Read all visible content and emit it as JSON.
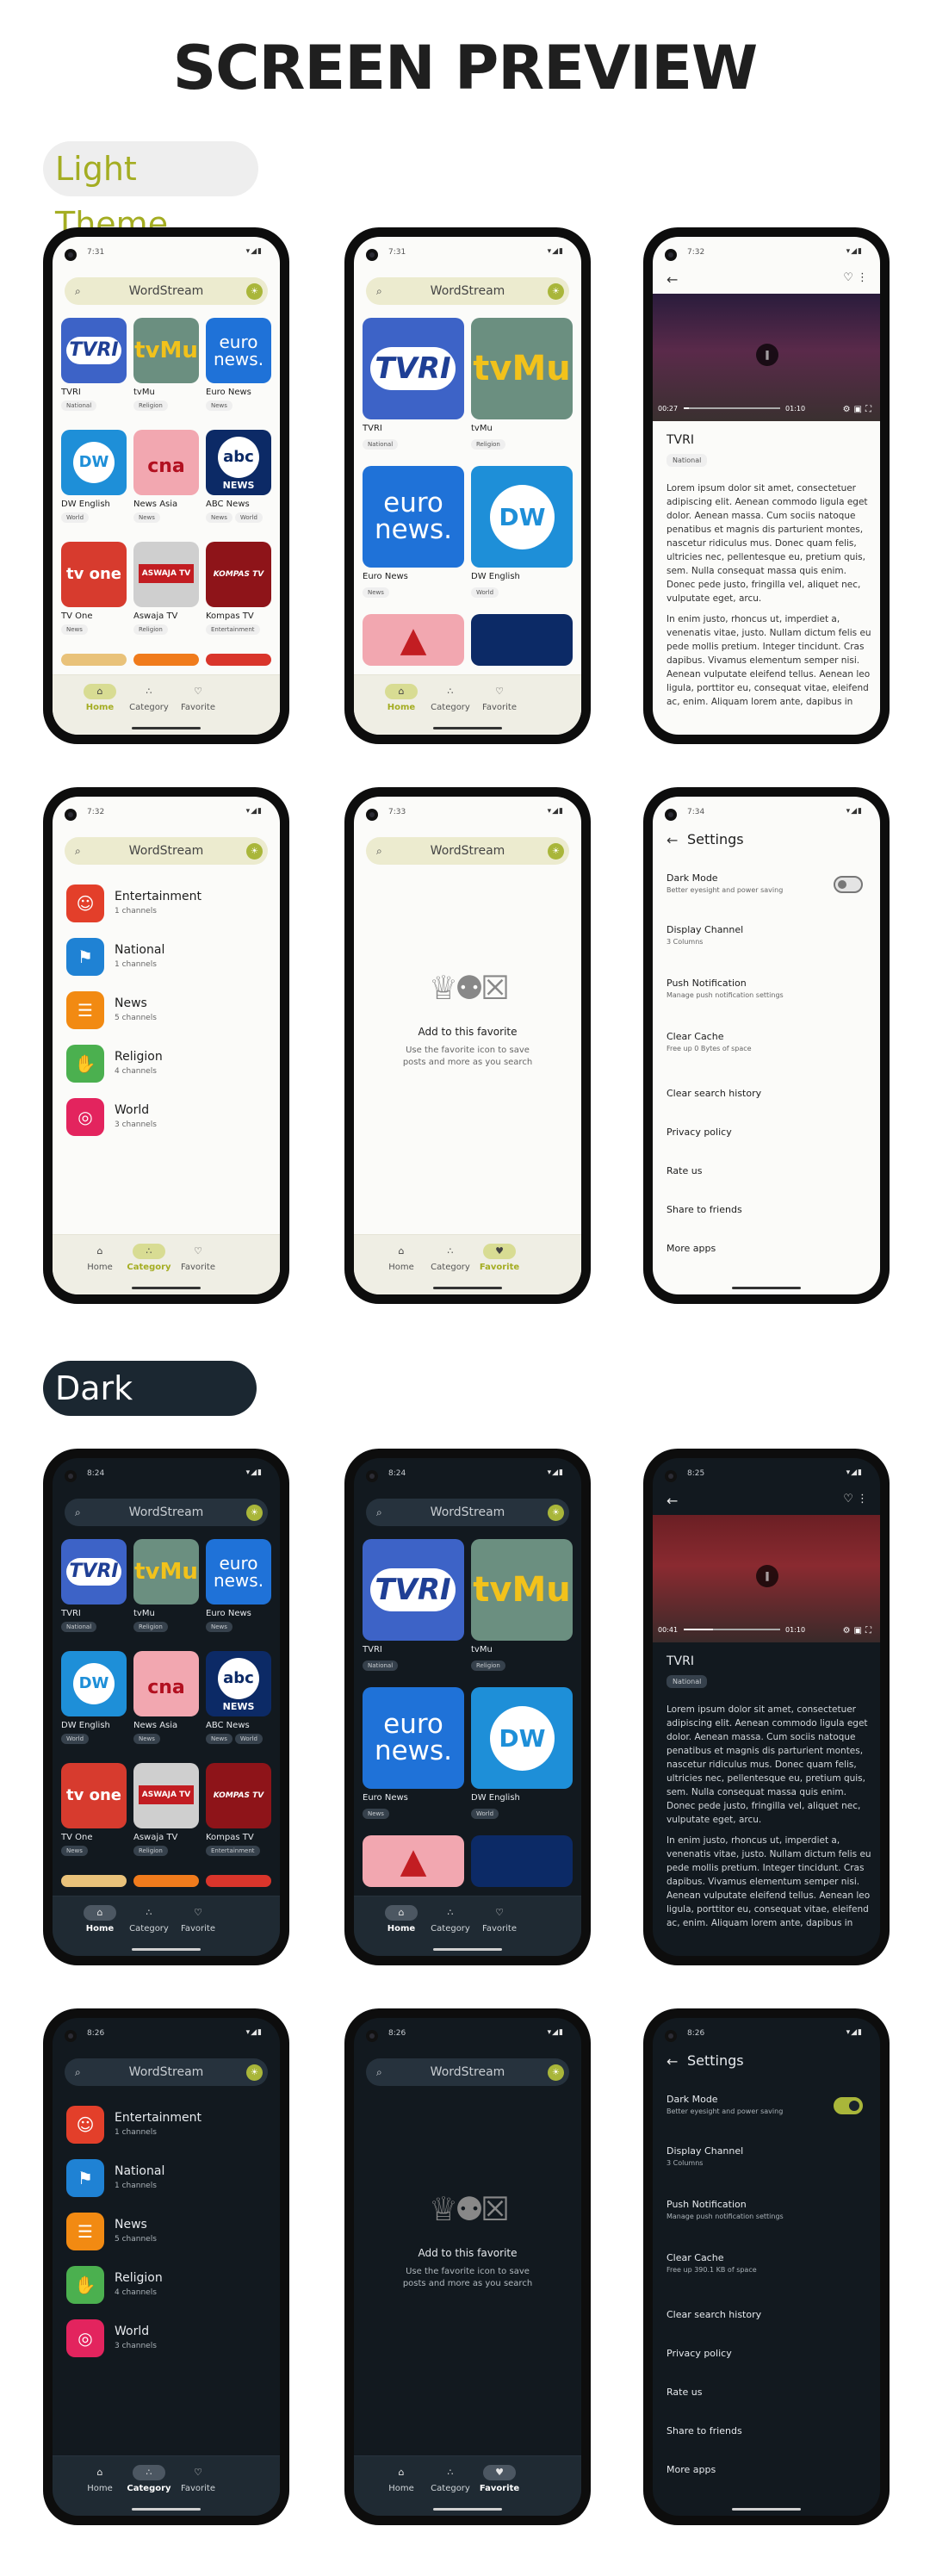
{
  "title": "SCREEN PREVIEW",
  "themes": {
    "light": "Light Theme",
    "dark": "Dark Theme"
  },
  "colors": {
    "accent": "#a9b63a",
    "light_bg": "#fbfbf9",
    "dark_bg": "#12191f"
  },
  "status": {
    "t1": "7:31",
    "t2": "7:31",
    "t3": "7:32",
    "t4": "7:32",
    "t5": "7:33",
    "t6": "7:34",
    "d1": "8:24",
    "d2": "8:24",
    "d3": "8:25",
    "d4": "8:26",
    "d5": "8:26",
    "d6": "8:26",
    "icons": "▾◢▮"
  },
  "search": {
    "label": "WordStream",
    "icon": "search-icon"
  },
  "nav": {
    "home": "Home",
    "category": "Category",
    "favorite": "Favorite"
  },
  "channels": [
    {
      "name": "TVRI",
      "tags": [
        "National"
      ]
    },
    {
      "name": "tvMu",
      "tags": [
        "Religion"
      ]
    },
    {
      "name": "Euro News",
      "tags": [
        "News"
      ]
    },
    {
      "name": "DW English",
      "tags": [
        "World"
      ]
    },
    {
      "name": "News Asia",
      "tags": [
        "News"
      ]
    },
    {
      "name": "ABC News",
      "tags": [
        "News",
        "World"
      ]
    },
    {
      "name": "TV One",
      "tags": [
        "News"
      ]
    },
    {
      "name": "Aswaja TV",
      "tags": [
        "Religion"
      ]
    },
    {
      "name": "Kompas TV",
      "tags": [
        "Entertainment"
      ]
    }
  ],
  "logos": {
    "tvri": "TVRI",
    "tvmu": "tvMu",
    "euro1": "euro",
    "euro2": "news.",
    "dw": "DW",
    "cna": "cna",
    "abc": "abc",
    "abc2": "NEWS",
    "tvone": "tv one",
    "aswaja": "ASWAJA TV",
    "kompas": "KOMPAS TV"
  },
  "categories": [
    {
      "name": "Entertainment",
      "count": "1 channels"
    },
    {
      "name": "National",
      "count": "1 channels"
    },
    {
      "name": "News",
      "count": "5 channels"
    },
    {
      "name": "Religion",
      "count": "4 channels"
    },
    {
      "name": "World",
      "count": "3 channels"
    }
  ],
  "favorite": {
    "title": "Add to this favorite",
    "sub": "Use the favorite icon to save posts and more as you search"
  },
  "detail": {
    "title": "TVRI",
    "tag": "National",
    "time_light": "00:27",
    "time_dark": "00:41",
    "duration": "01:10",
    "progress_light": 0.05,
    "progress_dark": 0.3,
    "p1": "Lorem ipsum dolor sit amet, consectetuer adipiscing elit. Aenean commodo ligula eget dolor. Aenean massa. Cum sociis natoque penatibus et magnis dis parturient montes, nascetur ridiculus mus. Donec quam felis, ultricies nec, pellentesque eu, pretium quis, sem. Nulla consequat massa quis enim. Donec pede justo, fringilla vel, aliquet nec, vulputate eget, arcu.",
    "p2": "In enim justo, rhoncus ut, imperdiet a, venenatis vitae, justo. Nullam dictum felis eu pede mollis pretium. Integer tincidunt. Cras dapibus. Vivamus elementum semper nisi. Aenean vulputate eleifend tellus. Aenean leo ligula, porttitor eu, consequat vitae, eleifend ac, enim. Aliquam lorem ante, dapibus in"
  },
  "settings": {
    "title": "Settings",
    "dark_mode": "Dark Mode",
    "dark_mode_sub": "Better eyesight and power saving",
    "display": "Display Channel",
    "display_sub": "3 Columns",
    "push": "Push Notification",
    "push_sub": "Manage push notification settings",
    "cache": "Clear Cache",
    "cache_sub_light": "Free up 0 Bytes of space",
    "cache_sub_dark": "Free up 390.1 KB of space",
    "history": "Clear search history",
    "privacy": "Privacy policy",
    "rate": "Rate us",
    "share": "Share to friends",
    "more": "More apps",
    "dark_mode_light_on": false,
    "dark_mode_dark_on": true
  }
}
